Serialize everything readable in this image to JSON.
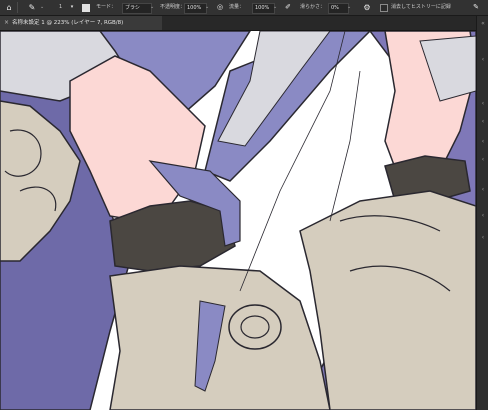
{
  "options_bar": {
    "home_icon": "home-icon",
    "eraser_icon": "eraser-icon",
    "brush_size": "1",
    "mode_label": "モード：",
    "mode_value": "ブラシ",
    "opacity_label": "不透明度：",
    "opacity_value": "100%",
    "flow_label": "流量：",
    "flow_value": "100%",
    "smoothing_label": "滑らかさ：",
    "smoothing_value": "0%",
    "history_label": "消去してヒストリーに記録"
  },
  "document_tab": {
    "title": "名称未設定 1 @ 223% (レイヤー 7, RGB/8)"
  },
  "artwork": {
    "description_colors": {
      "skin": "#fcd8d5",
      "lavender": "#8a8ac4",
      "dark_lavender": "#6e6aa8",
      "beige": "#d5cdbe",
      "glove": "#4b4742",
      "line": "#2a2830",
      "light_gray": "#d9d9df"
    }
  },
  "right_panel": {
    "icons": [
      "collapse-icon",
      "panel-icon-1",
      "panel-icon-2",
      "panel-icon-3",
      "panel-icon-4",
      "panel-icon-5",
      "panel-icon-6",
      "panel-icon-7",
      "panel-icon-8"
    ]
  }
}
